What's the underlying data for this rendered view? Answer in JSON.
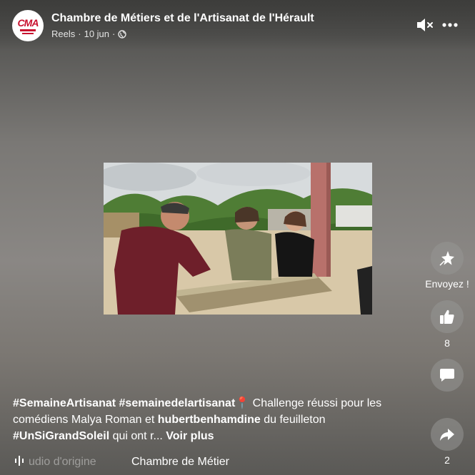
{
  "header": {
    "page_name": "Chambre de Métiers et de l'Artisanat de l'Hérault",
    "meta_type": "Reels",
    "meta_separator": "·",
    "meta_date": "10 jun",
    "meta_dot": "·",
    "avatar_logo": "CMA"
  },
  "actions": {
    "send_label": "Envoyez !",
    "like_count": "8",
    "share_count": "2"
  },
  "caption": {
    "tag1": "#SemaineArtisanat",
    "tag2": "#semainedelartisanat",
    "pin": "📍",
    "text1": " Challenge réussi pour les comédiens Malya Roman et ",
    "mention": "hubertbenhamdine",
    "text2": " du feuilleton ",
    "tag3": "#UnSiGrandSoleil",
    "text3": " qui ont r... ",
    "see_more": "Voir plus"
  },
  "audio": {
    "label": "udio d'origine",
    "author": "Chambre de Métier"
  },
  "icons": {
    "mute": "speaker-muted-icon",
    "more": "more-icon",
    "send": "sparkle-send-icon",
    "like": "thumbs-up-icon",
    "comment": "comment-icon",
    "share": "share-arrow-icon",
    "audio": "audio-wave-icon",
    "globe": "globe-icon"
  },
  "colors": {
    "brand_red": "#c8102e",
    "text": "#ffffff"
  }
}
